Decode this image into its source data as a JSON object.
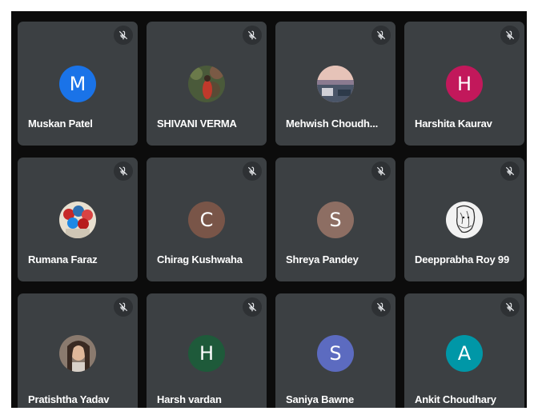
{
  "participants": [
    {
      "name": "Muskan Patel",
      "initial": "M",
      "color": "#1a73e8",
      "avatar": "letter",
      "muted_icon": "mic-off-icon"
    },
    {
      "name": "SHIVANI VERMA",
      "initial": "",
      "color": "#5a4a3a",
      "avatar": "photo",
      "muted_icon": "mic-off-icon"
    },
    {
      "name": "Mehwish Choudh...",
      "initial": "",
      "color": "#7a6a80",
      "avatar": "photo",
      "muted_icon": "mic-off-icon"
    },
    {
      "name": "Harshita Kaurav",
      "initial": "H",
      "color": "#c2185b",
      "avatar": "letter",
      "muted_icon": "mic-off-icon"
    },
    {
      "name": "Rumana Faraz",
      "initial": "",
      "color": "#b84a4a",
      "avatar": "photo",
      "muted_icon": "mic-off-icon"
    },
    {
      "name": "Chirag Kushwaha",
      "initial": "C",
      "color": "#795548",
      "avatar": "letter",
      "muted_icon": "mic-off-icon"
    },
    {
      "name": "Shreya Pandey",
      "initial": "S",
      "color": "#8d6e63",
      "avatar": "letter",
      "muted_icon": "mic-off-icon"
    },
    {
      "name": "Deepprabha Roy 99",
      "initial": "",
      "color": "#d8d8d8",
      "avatar": "photo",
      "muted_icon": "mic-off-icon"
    },
    {
      "name": "Pratishtha Yadav",
      "initial": "",
      "color": "#6b5a50",
      "avatar": "photo",
      "muted_icon": "mic-off-icon"
    },
    {
      "name": "Harsh vardan",
      "initial": "H",
      "color": "#1e5a3a",
      "avatar": "letter",
      "muted_icon": "mic-off-icon"
    },
    {
      "name": "Saniya Bawne",
      "initial": "S",
      "color": "#5c6bc0",
      "avatar": "letter",
      "muted_icon": "mic-off-icon"
    },
    {
      "name": "Ankit Choudhary",
      "initial": "A",
      "color": "#0097a7",
      "avatar": "letter",
      "muted_icon": "mic-off-icon"
    }
  ]
}
